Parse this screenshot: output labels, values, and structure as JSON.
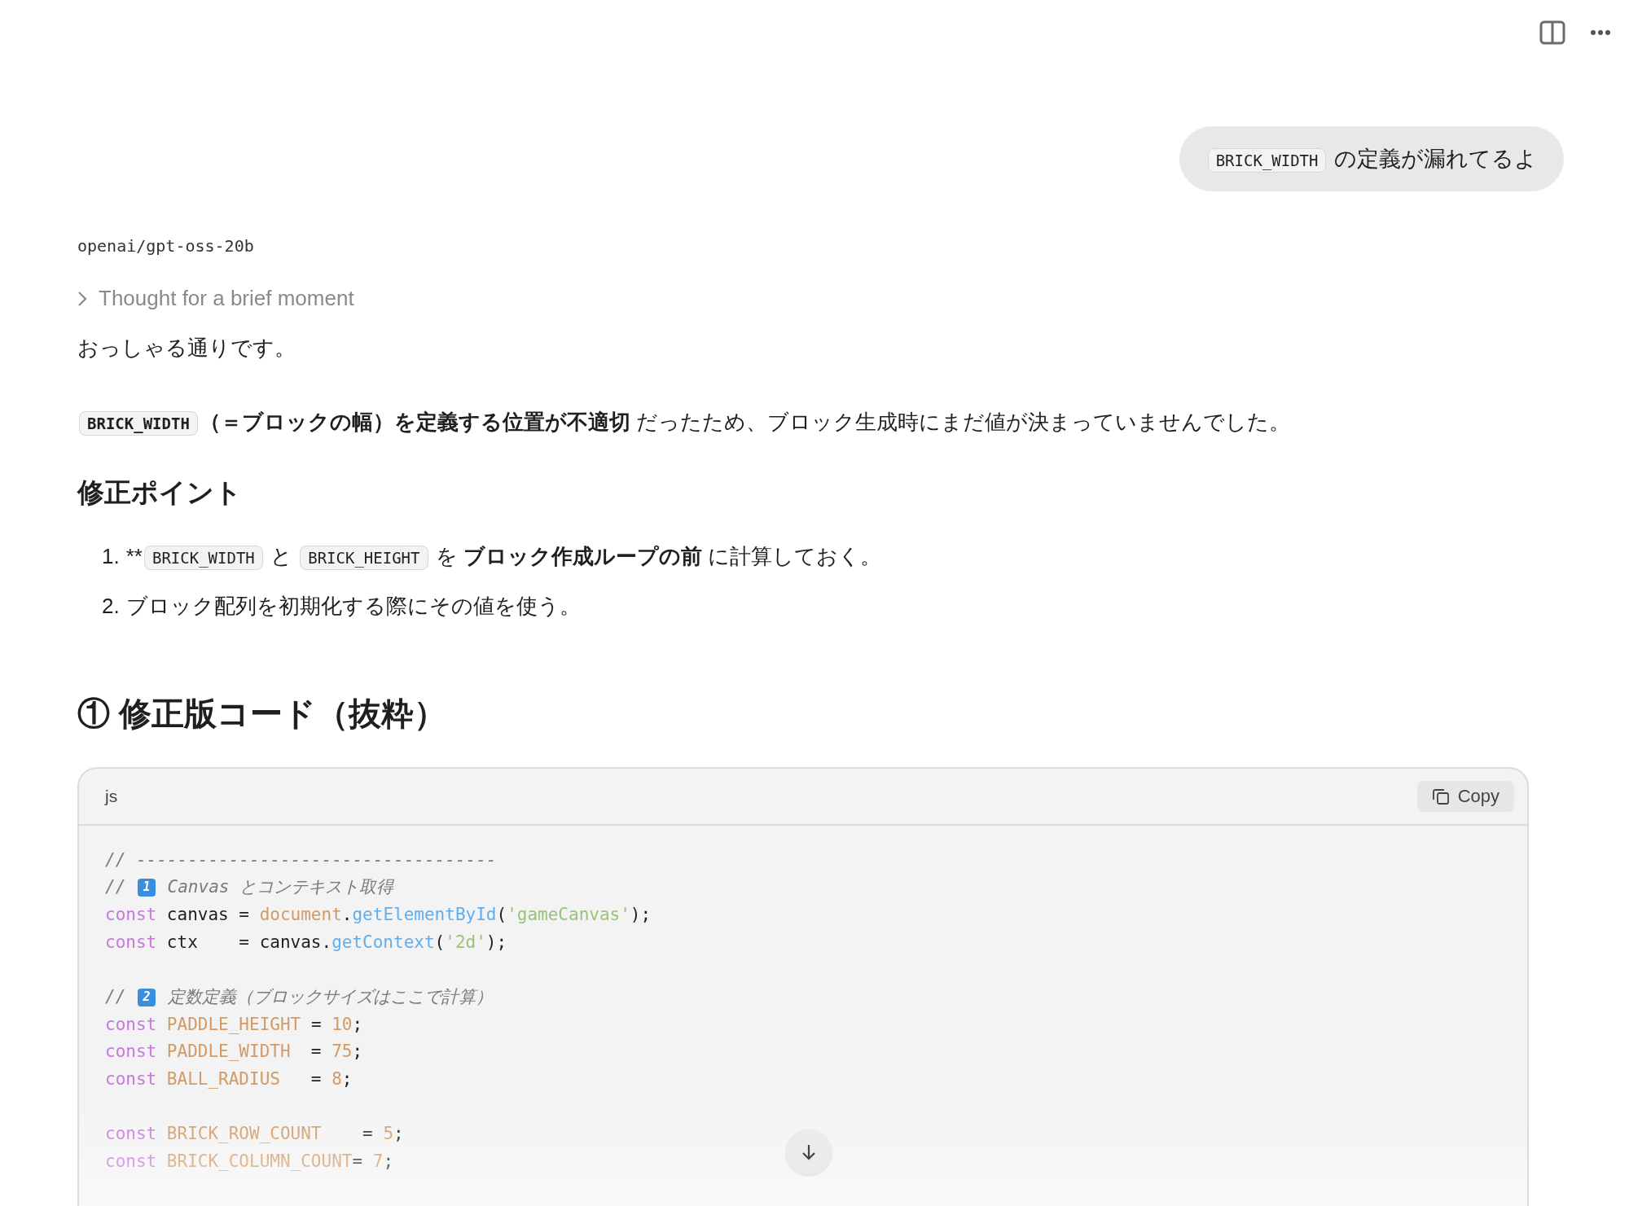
{
  "user_message": {
    "segments": [
      {
        "kind": "code",
        "text": "BRICK_WIDTH"
      },
      {
        "kind": "text",
        "text": " の定義が漏れてるよ"
      }
    ]
  },
  "assistant": {
    "model": "openai/gpt-oss-20b",
    "thought": {
      "label": "Thought for a brief moment",
      "expanded": false
    },
    "intro": "おっしゃる通りです。",
    "explanation": [
      {
        "kind": "code",
        "text": "BRICK_WIDTH"
      },
      {
        "kind": "bold",
        "text": "（＝ブロックの幅）を定義する位置が不適切"
      },
      {
        "kind": "text",
        "text": " だったため、ブロック生成時にまだ値が決まっていませんでした。"
      }
    ],
    "section_heading": "修正ポイント",
    "points": [
      {
        "number": "1.",
        "segments": [
          {
            "kind": "text",
            "text": "**"
          },
          {
            "kind": "code",
            "text": "BRICK_WIDTH"
          },
          {
            "kind": "text",
            "text": " と "
          },
          {
            "kind": "code",
            "text": "BRICK_HEIGHT"
          },
          {
            "kind": "text",
            "text": " を "
          },
          {
            "kind": "bold",
            "text": "ブロック作成ループの前"
          },
          {
            "kind": "text",
            "text": " に計算しておく。"
          }
        ]
      },
      {
        "number": "2.",
        "segments": [
          {
            "kind": "text",
            "text": "ブロック配列を初期化する際にその値を使う。"
          }
        ]
      }
    ],
    "code_heading": "① 修正版コード（抜粋）",
    "code_block": {
      "language": "js",
      "copy_label": "Copy",
      "lines": [
        {
          "kind": "code",
          "tokens": [
            {
              "kind": "comment",
              "text": "// -----------------------------------"
            }
          ]
        },
        {
          "kind": "code",
          "tokens": [
            {
              "kind": "comment",
              "text": "// "
            },
            {
              "kind": "badge",
              "text": "1"
            },
            {
              "kind": "comment",
              "text": " Canvas とコンテキスト取得"
            }
          ]
        },
        {
          "kind": "code",
          "tokens": [
            {
              "kind": "keyword",
              "text": "const "
            },
            {
              "kind": "plain",
              "text": "canvas = "
            },
            {
              "kind": "object",
              "text": "document"
            },
            {
              "kind": "plain",
              "text": "."
            },
            {
              "kind": "function",
              "text": "getElementById"
            },
            {
              "kind": "plain",
              "text": "("
            },
            {
              "kind": "string",
              "text": "'gameCanvas'"
            },
            {
              "kind": "plain",
              "text": ");"
            }
          ]
        },
        {
          "kind": "code",
          "tokens": [
            {
              "kind": "keyword",
              "text": "const "
            },
            {
              "kind": "plain",
              "text": "ctx    = canvas."
            },
            {
              "kind": "function",
              "text": "getContext"
            },
            {
              "kind": "plain",
              "text": "("
            },
            {
              "kind": "string",
              "text": "'2d'"
            },
            {
              "kind": "plain",
              "text": ");"
            }
          ]
        },
        {
          "kind": "blank"
        },
        {
          "kind": "code",
          "tokens": [
            {
              "kind": "comment",
              "text": "// "
            },
            {
              "kind": "badge",
              "text": "2"
            },
            {
              "kind": "comment",
              "text": " 定数定義（ブロックサイズはここで計算）"
            }
          ]
        },
        {
          "kind": "code",
          "tokens": [
            {
              "kind": "keyword",
              "text": "const "
            },
            {
              "kind": "object",
              "text": "PADDLE_HEIGHT"
            },
            {
              "kind": "plain",
              "text": " = "
            },
            {
              "kind": "number",
              "text": "10"
            },
            {
              "kind": "plain",
              "text": ";"
            }
          ]
        },
        {
          "kind": "code",
          "tokens": [
            {
              "kind": "keyword",
              "text": "const "
            },
            {
              "kind": "object",
              "text": "PADDLE_WIDTH"
            },
            {
              "kind": "plain",
              "text": "  = "
            },
            {
              "kind": "number",
              "text": "75"
            },
            {
              "kind": "plain",
              "text": ";"
            }
          ]
        },
        {
          "kind": "code",
          "tokens": [
            {
              "kind": "keyword",
              "text": "const "
            },
            {
              "kind": "object",
              "text": "BALL_RADIUS"
            },
            {
              "kind": "plain",
              "text": "   = "
            },
            {
              "kind": "number",
              "text": "8"
            },
            {
              "kind": "plain",
              "text": ";"
            }
          ]
        },
        {
          "kind": "blank"
        },
        {
          "kind": "code",
          "tokens": [
            {
              "kind": "keyword",
              "text": "const "
            },
            {
              "kind": "object",
              "text": "BRICK_ROW_COUNT"
            },
            {
              "kind": "plain",
              "text": "    = "
            },
            {
              "kind": "number",
              "text": "5"
            },
            {
              "kind": "plain",
              "text": ";"
            }
          ]
        },
        {
          "kind": "code",
          "tokens": [
            {
              "kind": "keyword",
              "text": "const "
            },
            {
              "kind": "object",
              "text": "BRICK_COLUMN_COUNT"
            },
            {
              "kind": "plain",
              "text": "= "
            },
            {
              "kind": "number",
              "text": "7"
            },
            {
              "kind": "plain",
              "text": ";"
            }
          ]
        }
      ]
    }
  }
}
